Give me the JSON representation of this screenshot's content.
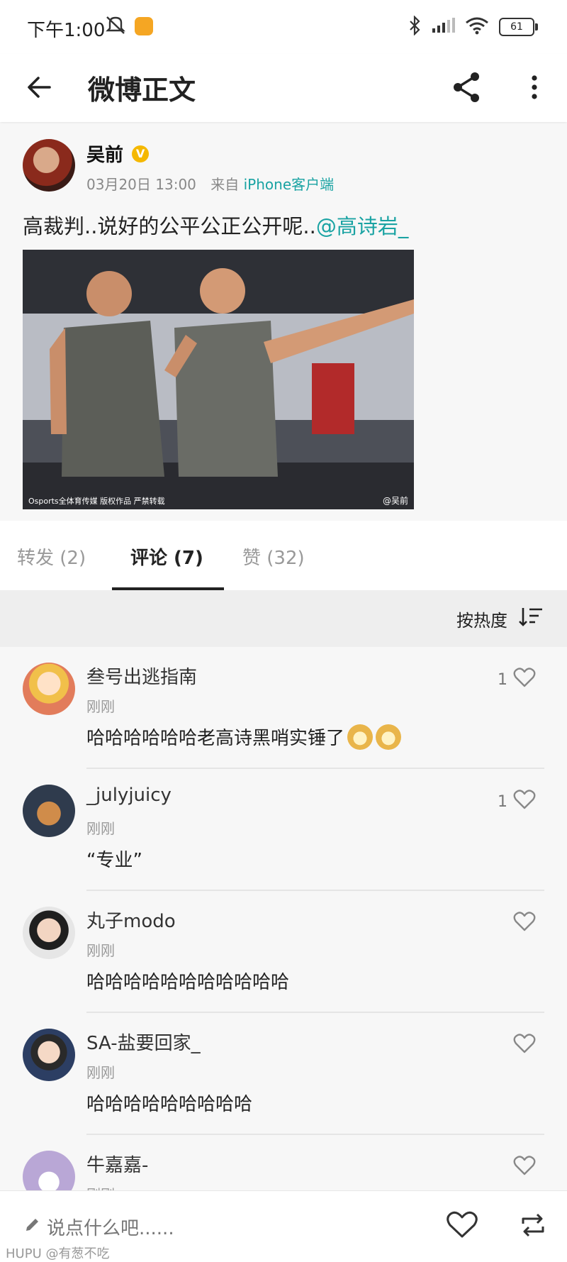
{
  "statusbar": {
    "time": "下午1:00",
    "battery": "61"
  },
  "header": {
    "title": "微博正文"
  },
  "post": {
    "author": "吴前",
    "verified_badge": "V",
    "date": "03月20日 13:00",
    "from_label": "来自",
    "source": "iPhone客户端",
    "text": "高裁判..说好的公平公正公开呢..",
    "mention": "@高诗岩_",
    "image": {
      "watermark_left": "Osports全体育传媒 版权作品 严禁转载",
      "watermark_right": "@吴前"
    }
  },
  "tabs": [
    {
      "label": "转发 (2)"
    },
    {
      "label": "评论 (7)"
    },
    {
      "label": "赞 (32)"
    }
  ],
  "sort": {
    "label": "按热度"
  },
  "comments": [
    {
      "name": "叁号出逃指南",
      "time": "刚刚",
      "text": "哈哈哈哈哈哈老高诗黑哨实锤了",
      "likes": "1",
      "avatar_color": "#e9a37a"
    },
    {
      "name": "_julyjuicy",
      "time": "刚刚",
      "text": "“专业”",
      "likes": "1",
      "avatar_color": "#2f3b4d"
    },
    {
      "name": "丸子modo",
      "time": "刚刚",
      "text": "哈哈哈哈哈哈哈哈哈哈哈",
      "likes": "",
      "avatar_color": "#d9d9d9"
    },
    {
      "name": "SA-盐要回家_",
      "time": "刚刚",
      "text": "哈哈哈哈哈哈哈哈哈",
      "likes": "",
      "avatar_color": "#2c3e63"
    },
    {
      "name": "牛嘉嘉-",
      "time": "刚刚",
      "text": "",
      "likes": "",
      "avatar_color": "#b9a7d6"
    }
  ],
  "bottombar": {
    "placeholder": "说点什么吧......",
    "watermark": "HUPU @有葱不吃"
  },
  "icons": {
    "back": "arrow-left-icon",
    "share": "share-icon",
    "more": "more-vertical-icon",
    "sort": "sort-icon",
    "heart": "heart-icon",
    "repost": "repost-icon",
    "edit": "pencil-icon"
  }
}
